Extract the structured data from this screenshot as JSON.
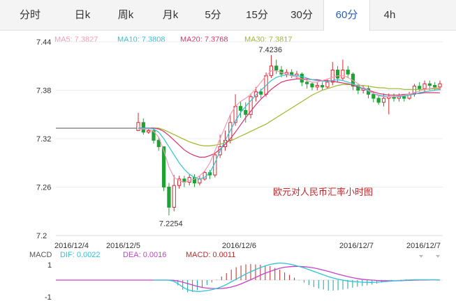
{
  "tabs": [
    "分时",
    "日k",
    "周k",
    "月k",
    "5分",
    "15分",
    "30分",
    "60分",
    "4h"
  ],
  "active_tab": "60分",
  "colors": {
    "up": "#d9272e",
    "down": "#1ea234",
    "ma5": "#f29bb5",
    "ma10": "#2ec3d5",
    "ma20": "#d9306e",
    "ma30": "#9fb72b",
    "dif": "#2ec3d5",
    "dea": "#c640c9",
    "macd": "#c0282b",
    "title": "#c0282b"
  },
  "chart_data": {
    "type": "candlestick",
    "title": "欧元对人民币汇率小时图",
    "ylim": [
      7.2,
      7.44
    ],
    "yticks": [
      "7.44",
      "7.38",
      "7.32",
      "7.26",
      "7.2"
    ],
    "x_labels": [
      "2016/12/4",
      "2016/12/5",
      "2016/12/6",
      "2016/12/7",
      "2016/12/7"
    ],
    "ma_legend": [
      {
        "name": "MA5",
        "value": "7.3827"
      },
      {
        "name": "MA10",
        "value": "7.3808"
      },
      {
        "name": "MA20",
        "value": "7.3768"
      },
      {
        "name": "MA30",
        "value": "7.3817"
      }
    ],
    "annotations": {
      "high": "7.4236",
      "low": "7.2254"
    },
    "candles": [
      [
        7.33,
        7.34,
        7.33,
        7.352
      ],
      [
        7.34,
        7.328,
        7.325,
        7.345
      ],
      [
        7.328,
        7.33,
        7.326,
        7.334
      ],
      [
        7.33,
        7.318,
        7.314,
        7.332
      ],
      [
        7.318,
        7.31,
        7.305,
        7.322
      ],
      [
        7.31,
        7.26,
        7.255,
        7.31
      ],
      [
        7.26,
        7.235,
        7.225,
        7.265
      ],
      [
        7.235,
        7.262,
        7.23,
        7.275
      ],
      [
        7.262,
        7.27,
        7.258,
        7.274
      ],
      [
        7.27,
        7.266,
        7.26,
        7.274
      ],
      [
        7.266,
        7.272,
        7.262,
        7.276
      ],
      [
        7.272,
        7.265,
        7.26,
        7.276
      ],
      [
        7.265,
        7.27,
        7.262,
        7.274
      ],
      [
        7.27,
        7.278,
        7.268,
        7.28
      ],
      [
        7.278,
        7.275,
        7.27,
        7.281
      ],
      [
        7.275,
        7.3,
        7.272,
        7.302
      ],
      [
        7.3,
        7.31,
        7.296,
        7.325
      ],
      [
        7.31,
        7.318,
        7.305,
        7.33
      ],
      [
        7.318,
        7.34,
        7.314,
        7.35
      ],
      [
        7.34,
        7.36,
        7.336,
        7.375
      ],
      [
        7.36,
        7.355,
        7.346,
        7.366
      ],
      [
        7.355,
        7.35,
        7.34,
        7.365
      ],
      [
        7.35,
        7.372,
        7.345,
        7.376
      ],
      [
        7.372,
        7.378,
        7.366,
        7.384
      ],
      [
        7.378,
        7.375,
        7.37,
        7.382
      ],
      [
        7.375,
        7.398,
        7.372,
        7.402
      ],
      [
        7.398,
        7.41,
        7.395,
        7.4236
      ],
      [
        7.41,
        7.405,
        7.4,
        7.418
      ],
      [
        7.405,
        7.4,
        7.396,
        7.41
      ],
      [
        7.4,
        7.402,
        7.396,
        7.406
      ],
      [
        7.402,
        7.398,
        7.395,
        7.406
      ],
      [
        7.398,
        7.4,
        7.394,
        7.404
      ],
      [
        7.4,
        7.39,
        7.385,
        7.402
      ],
      [
        7.39,
        7.388,
        7.382,
        7.394
      ],
      [
        7.388,
        7.384,
        7.38,
        7.39
      ],
      [
        7.384,
        7.386,
        7.38,
        7.39
      ],
      [
        7.386,
        7.384,
        7.38,
        7.39
      ],
      [
        7.384,
        7.39,
        7.382,
        7.394
      ],
      [
        7.39,
        7.405,
        7.386,
        7.415
      ],
      [
        7.405,
        7.395,
        7.39,
        7.41
      ],
      [
        7.395,
        7.405,
        7.392,
        7.418
      ],
      [
        7.405,
        7.4,
        7.395,
        7.41
      ],
      [
        7.4,
        7.385,
        7.38,
        7.402
      ],
      [
        7.385,
        7.38,
        7.375,
        7.388
      ],
      [
        7.38,
        7.382,
        7.376,
        7.386
      ],
      [
        7.382,
        7.375,
        7.37,
        7.386
      ],
      [
        7.375,
        7.37,
        7.365,
        7.378
      ],
      [
        7.37,
        7.365,
        7.362,
        7.374
      ],
      [
        7.365,
        7.37,
        7.36,
        7.376
      ],
      [
        7.37,
        7.372,
        7.35,
        7.376
      ],
      [
        7.372,
        7.37,
        7.366,
        7.376
      ],
      [
        7.37,
        7.372,
        7.366,
        7.376
      ],
      [
        7.372,
        7.37,
        7.366,
        7.375
      ],
      [
        7.37,
        7.375,
        7.368,
        7.378
      ],
      [
        7.375,
        7.385,
        7.372,
        7.388
      ],
      [
        7.385,
        7.382,
        7.378,
        7.39
      ],
      [
        7.382,
        7.388,
        7.378,
        7.392
      ],
      [
        7.388,
        7.386,
        7.38,
        7.392
      ],
      [
        7.386,
        7.384,
        7.38,
        7.39
      ],
      [
        7.384,
        7.388,
        7.38,
        7.392
      ]
    ],
    "ma5": [
      7.332,
      7.332,
      7.332,
      7.329,
      7.322,
      7.305,
      7.285,
      7.272,
      7.268,
      7.266,
      7.268,
      7.27,
      7.274,
      7.28,
      7.29,
      7.305,
      7.32,
      7.335,
      7.35,
      7.36,
      7.366,
      7.37,
      7.375,
      7.382,
      7.39,
      7.398,
      7.404,
      7.404,
      7.402,
      7.4,
      7.398,
      7.396,
      7.394,
      7.392,
      7.39,
      7.39,
      7.392,
      7.394,
      7.396,
      7.398,
      7.398,
      7.396,
      7.392,
      7.388,
      7.384,
      7.38,
      7.376,
      7.373,
      7.372,
      7.372,
      7.372,
      7.373,
      7.374,
      7.375,
      7.377,
      7.379,
      7.381,
      7.382,
      7.383,
      7.3827
    ],
    "ma10": [
      7.333,
      7.333,
      7.333,
      7.332,
      7.328,
      7.32,
      7.31,
      7.3,
      7.29,
      7.282,
      7.276,
      7.272,
      7.27,
      7.272,
      7.278,
      7.29,
      7.305,
      7.318,
      7.33,
      7.342,
      7.352,
      7.36,
      7.367,
      7.374,
      7.38,
      7.386,
      7.392,
      7.396,
      7.398,
      7.399,
      7.399,
      7.398,
      7.397,
      7.395,
      7.393,
      7.392,
      7.391,
      7.391,
      7.392,
      7.393,
      7.392,
      7.39,
      7.388,
      7.385,
      7.382,
      7.379,
      7.376,
      7.374,
      7.373,
      7.372,
      7.372,
      7.372,
      7.373,
      7.374,
      7.375,
      7.377,
      7.378,
      7.379,
      7.38,
      7.3808
    ],
    "ma20": [
      7.333,
      7.333,
      7.333,
      7.333,
      7.332,
      7.329,
      7.324,
      7.318,
      7.312,
      7.306,
      7.302,
      7.299,
      7.297,
      7.297,
      7.299,
      7.302,
      7.307,
      7.313,
      7.32,
      7.328,
      7.337,
      7.346,
      7.354,
      7.362,
      7.369,
      7.375,
      7.381,
      7.386,
      7.39,
      7.392,
      7.393,
      7.394,
      7.394,
      7.394,
      7.393,
      7.393,
      7.392,
      7.392,
      7.391,
      7.39,
      7.389,
      7.388,
      7.386,
      7.384,
      7.382,
      7.38,
      7.378,
      7.376,
      7.375,
      7.374,
      7.374,
      7.374,
      7.375,
      7.375,
      7.376,
      7.376,
      7.377,
      7.377,
      7.377,
      7.3768
    ],
    "ma30": [
      7.333,
      7.333,
      7.333,
      7.333,
      7.333,
      7.331,
      7.328,
      7.325,
      7.322,
      7.319,
      7.316,
      7.314,
      7.312,
      7.311,
      7.311,
      7.312,
      7.313,
      7.315,
      7.317,
      7.32,
      7.323,
      7.326,
      7.329,
      7.332,
      7.335,
      7.338,
      7.342,
      7.346,
      7.35,
      7.354,
      7.358,
      7.362,
      7.366,
      7.37,
      7.374,
      7.377,
      7.38,
      7.382,
      7.384,
      7.386,
      7.387,
      7.387,
      7.387,
      7.386,
      7.386,
      7.385,
      7.384,
      7.383,
      7.383,
      7.382,
      7.382,
      7.382,
      7.381,
      7.381,
      7.381,
      7.381,
      7.381,
      7.3815,
      7.3817,
      7.3817
    ]
  },
  "macd": {
    "label": "MACD",
    "legend": [
      {
        "name": "DIF",
        "value": "0.0022"
      },
      {
        "name": "DEA",
        "value": "0.0016"
      },
      {
        "name": "MACD",
        "value": "0.0011"
      }
    ],
    "yticks": [
      "1",
      "-1"
    ],
    "ylim": [
      -1.2,
      1.2
    ],
    "dif": [
      0,
      0,
      0,
      0,
      -0.05,
      -0.2,
      -0.4,
      -0.55,
      -0.62,
      -0.65,
      -0.64,
      -0.6,
      -0.55,
      -0.48,
      -0.38,
      -0.25,
      -0.1,
      0.05,
      0.2,
      0.35,
      0.48,
      0.6,
      0.72,
      0.82,
      0.9,
      0.95,
      0.98,
      0.96,
      0.92,
      0.86,
      0.78,
      0.7,
      0.6,
      0.5,
      0.4,
      0.3,
      0.2,
      0.12,
      0.05,
      0,
      -0.05,
      -0.08,
      -0.1,
      -0.12,
      -0.13,
      -0.13,
      -0.12,
      -0.1,
      -0.08,
      -0.06,
      -0.04,
      -0.02,
      0,
      0.01,
      0.02,
      0.02,
      0.02,
      0.02,
      0.02,
      0.0022
    ],
    "dea": [
      0,
      0,
      0,
      0,
      -0.01,
      -0.05,
      -0.12,
      -0.2,
      -0.28,
      -0.36,
      -0.42,
      -0.46,
      -0.48,
      -0.49,
      -0.48,
      -0.45,
      -0.4,
      -0.32,
      -0.22,
      -0.1,
      0.02,
      0.15,
      0.28,
      0.4,
      0.5,
      0.6,
      0.68,
      0.74,
      0.77,
      0.79,
      0.79,
      0.77,
      0.74,
      0.7,
      0.64,
      0.57,
      0.5,
      0.42,
      0.34,
      0.27,
      0.2,
      0.14,
      0.09,
      0.05,
      0.02,
      0,
      -0.02,
      -0.03,
      -0.04,
      -0.04,
      -0.04,
      -0.03,
      -0.02,
      -0.01,
      0,
      0.01,
      0.01,
      0.015,
      0.016,
      0.0016
    ],
    "hist": [
      0,
      0,
      0,
      0,
      -0.08,
      -0.3,
      -0.55,
      -0.7,
      -0.68,
      -0.58,
      -0.44,
      -0.28,
      -0.14,
      0.02,
      0.2,
      0.4,
      0.6,
      0.74,
      0.84,
      0.9,
      0.92,
      0.9,
      0.88,
      0.84,
      0.8,
      0.7,
      0.6,
      0.44,
      0.3,
      0.14,
      -0.02,
      -0.14,
      -0.28,
      -0.4,
      -0.48,
      -0.54,
      -0.6,
      -0.6,
      -0.58,
      -0.54,
      -0.5,
      -0.44,
      -0.38,
      -0.34,
      -0.3,
      -0.26,
      -0.2,
      -0.14,
      -0.08,
      -0.04,
      0,
      0.02,
      0.04,
      0.04,
      0.04,
      0.02,
      0.02,
      0.01,
      0.01,
      0.0011
    ]
  }
}
